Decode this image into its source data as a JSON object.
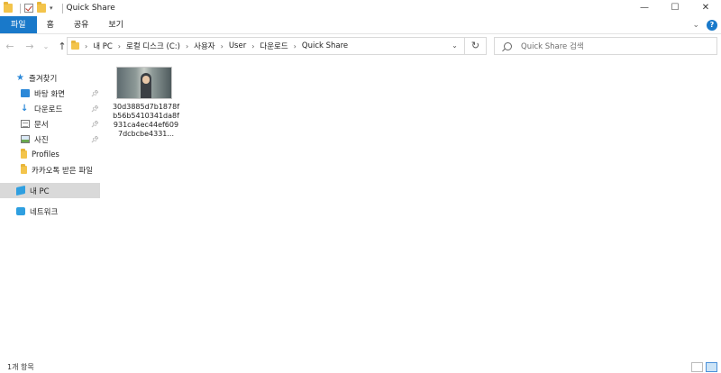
{
  "window": {
    "title": "Quick Share",
    "controls": {
      "minimize": "—",
      "maximize": "☐",
      "close": "✕"
    }
  },
  "ribbon": {
    "tabs": [
      "파일",
      "홈",
      "공유",
      "보기"
    ],
    "expand_icon": "chevron-down-icon",
    "help_label": "?"
  },
  "nav": {
    "back": "←",
    "forward": "→",
    "recent": "⌄",
    "up": "↑"
  },
  "address": {
    "breadcrumb": [
      "내 PC",
      "로컬 디스크 (C:)",
      "사용자",
      "User",
      "다운로드",
      "Quick Share"
    ],
    "refresh": "↻"
  },
  "search": {
    "placeholder": "Quick Share 검색"
  },
  "sidebar": {
    "quick_access": "즐겨찾기",
    "items": [
      {
        "label": "바탕 화면",
        "icon": "desktop-icon",
        "pinned": true
      },
      {
        "label": "다운로드",
        "icon": "download-icon",
        "pinned": true
      },
      {
        "label": "문서",
        "icon": "document-icon",
        "pinned": true
      },
      {
        "label": "사진",
        "icon": "picture-icon",
        "pinned": true
      },
      {
        "label": "Profiles",
        "icon": "folder-icon",
        "pinned": false
      },
      {
        "label": "카카오톡 받은 파일",
        "icon": "folder-icon",
        "pinned": false
      }
    ],
    "this_pc": "내 PC",
    "network": "네트워크"
  },
  "files": [
    {
      "name": "30d3885d7b1878fb56b5410341da8f931ca4ec44ef6097dcbcbe4331...",
      "icon": "image-thumbnail"
    }
  ],
  "status": {
    "count": "1개 항목"
  },
  "colors": {
    "accent": "#1979ca",
    "selected_bg": "#d9d9d9",
    "folder": "#f3c44b"
  }
}
